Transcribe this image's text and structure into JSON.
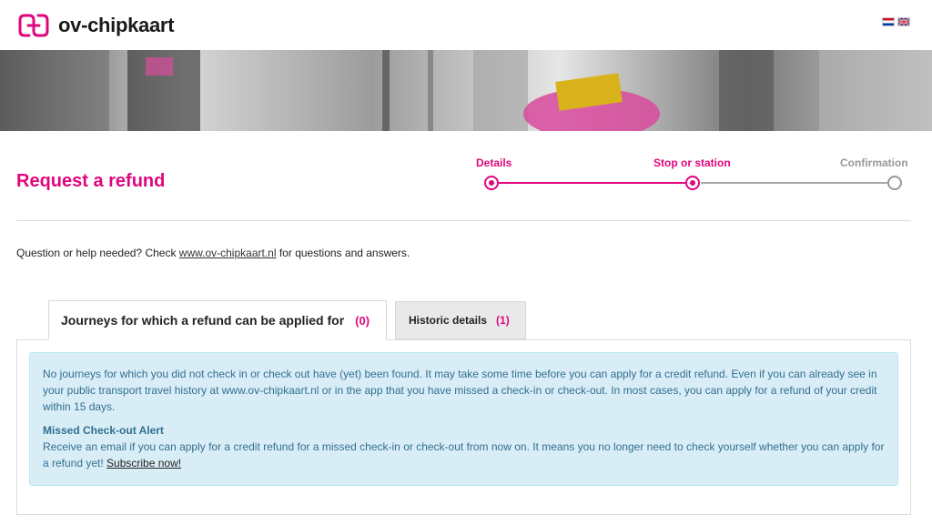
{
  "header": {
    "logo_text": "ov-chipkaart",
    "brand_color": "#e0067d",
    "languages": [
      "NL",
      "EN"
    ]
  },
  "banner": {
    "description_icon": "photo-banner"
  },
  "page": {
    "title": "Request a refund"
  },
  "steps": [
    {
      "label": "Details",
      "state": "done"
    },
    {
      "label": "Stop or station",
      "state": "current"
    },
    {
      "label": "Confirmation",
      "state": "todo"
    }
  ],
  "help": {
    "prefix": "Question or help needed? Check ",
    "link": "www.ov-chipkaart.nl",
    "suffix": " for questions and answers."
  },
  "tabs": [
    {
      "label": "Journeys for which a refund can be applied for",
      "count": "(0)",
      "active": true
    },
    {
      "label": "Historic details",
      "count": "(1)",
      "active": false
    }
  ],
  "alert": {
    "paragraph": "No journeys for which you did not check in or check out have (yet) been found. It may take some time before you can apply for a credit refund. Even if you can already see in your public transport travel history at www.ov-chipkaart.nl or in the app that you have missed a check-in or check-out. In most cases, you can apply for a refund of your credit within 15 days.",
    "title": "Missed Check-out Alert",
    "body": "Receive an email if you can apply for a credit refund for a missed check-in or check-out from now on. It means you no longer need to check yourself whether you can apply for a refund yet! ",
    "link": "Subscribe now!"
  }
}
